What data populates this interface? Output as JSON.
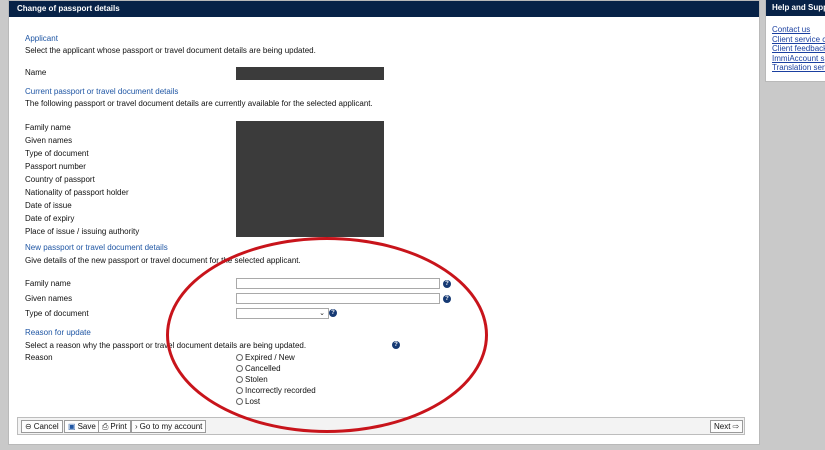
{
  "panel": {
    "title": "Change of passport details"
  },
  "sidebar": {
    "title": "Help and Supp",
    "links": [
      "Contact us",
      "Client service c",
      "Client feedback",
      "ImmiAccount s",
      "Translation serv"
    ]
  },
  "applicant": {
    "title": "Applicant",
    "desc": "Select the applicant whose passport or travel document details are being updated.",
    "name_label": "Name"
  },
  "current": {
    "title": "Current passport or travel document details",
    "desc": "The following passport or travel document details are currently available for the selected applicant.",
    "labels": [
      "Family name",
      "Given names",
      "Type of document",
      "Passport number",
      "Country of passport",
      "Nationality of passport holder",
      "Date of issue",
      "Date of expiry",
      "Place of issue / issuing authority"
    ]
  },
  "new_details": {
    "title": "New passport or travel document details",
    "desc": "Give details of the new passport or travel document for the selected applicant.",
    "family_label": "Family name",
    "given_label": "Given names",
    "type_label": "Type of document",
    "family_value": "",
    "given_value": "",
    "type_value": ""
  },
  "reason": {
    "title": "Reason for update",
    "desc": "Select a reason why the passport or travel document details are being updated.",
    "label": "Reason",
    "options": [
      "Expired / New",
      "Cancelled",
      "Stolen",
      "Incorrectly recorded",
      "Lost"
    ]
  },
  "footer": {
    "cancel": "Cancel",
    "save": "Save",
    "print": "Print",
    "account": "Go to my account",
    "next": "Next"
  },
  "icons": {
    "help": "?",
    "chevron": "⌄"
  },
  "colors": {
    "header_bg": "#072247",
    "section_title": "#1f56a4",
    "annotation": "#c8141b",
    "redaction": "#3b3b3b"
  }
}
